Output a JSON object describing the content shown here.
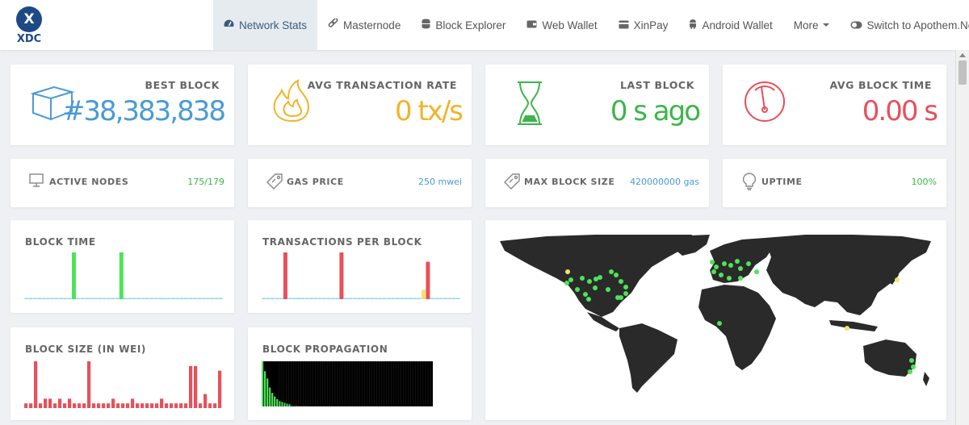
{
  "brand": {
    "logo_letter": "X",
    "name": "XDC"
  },
  "nav": {
    "items": [
      {
        "label": "Network Stats",
        "icon": "gauge-icon",
        "active": true
      },
      {
        "label": "Masternode",
        "icon": "link-icon"
      },
      {
        "label": "Block Explorer",
        "icon": "database-icon"
      },
      {
        "label": "Web Wallet",
        "icon": "wallet-icon"
      },
      {
        "label": "XinPay",
        "icon": "card-icon"
      },
      {
        "label": "Android Wallet",
        "icon": "android-icon"
      },
      {
        "label": "More",
        "icon": "caret-down-icon"
      },
      {
        "label": "Switch to Apothem.Network",
        "icon": "toggle-icon"
      }
    ]
  },
  "stats": {
    "best_block": {
      "label": "BEST BLOCK",
      "value": "#38,383,838",
      "color": "#4a9bd4"
    },
    "avg_tx_rate": {
      "label": "AVG TRANSACTION RATE",
      "value": "0 tx/s",
      "color": "#f0b429"
    },
    "last_block": {
      "label": "LAST BLOCK",
      "value": "0 s ago",
      "color": "#3cb54a"
    },
    "avg_block_time": {
      "label": "AVG BLOCK TIME",
      "value": "0.00 s",
      "color": "#e8505b"
    }
  },
  "small_stats": {
    "active_nodes": {
      "label": "ACTIVE NODES",
      "value": "175/179",
      "color": "#3cb54a"
    },
    "gas_price": {
      "label": "GAS PRICE",
      "value": "250 mwei",
      "color": "#4a9bd4"
    },
    "max_block_size": {
      "label": "MAX BLOCK SIZE",
      "value": "420000000 gas",
      "color": "#4a9bd4"
    },
    "uptime": {
      "label": "UPTIME",
      "value": "100%",
      "color": "#3cb54a"
    }
  },
  "charts": {
    "block_time": {
      "label": "BLOCK TIME"
    },
    "transactions_per_block": {
      "label": "TRANSACTIONS PER BLOCK"
    },
    "block_size": {
      "label": "BLOCK SIZE (IN WEI)"
    },
    "block_propagation": {
      "label": "BLOCK PROPAGATION"
    }
  },
  "chart_data": [
    {
      "type": "bar",
      "title": "BLOCK TIME",
      "values": [
        0,
        0,
        0,
        0,
        0,
        0,
        0,
        0,
        0,
        0,
        0,
        10,
        0,
        0,
        0,
        0,
        0,
        0,
        0,
        0,
        0,
        0,
        10,
        0,
        0,
        0,
        0,
        0,
        0,
        0,
        0,
        0,
        0,
        0,
        0,
        0,
        0,
        0,
        0,
        0,
        0,
        0,
        0,
        0,
        0,
        0
      ],
      "colors": {
        "high": "#4ee35a",
        "zero": "#8fd3ea"
      }
    },
    {
      "type": "bar",
      "title": "TRANSACTIONS PER BLOCK",
      "values": [
        0,
        0,
        0,
        0,
        0,
        10,
        0,
        0,
        0,
        0,
        0,
        0,
        0,
        0,
        0,
        0,
        0,
        0,
        10,
        0,
        0,
        0,
        0,
        0,
        0,
        0,
        0,
        0,
        0,
        0,
        0,
        0,
        0,
        0,
        0,
        0,
        0,
        2,
        8,
        0,
        0,
        0,
        0,
        0,
        0,
        0
      ],
      "highlight_index": 37,
      "colors": {
        "high": "#e8505b",
        "highlight": "#f2e36f",
        "zero": "#8fd3ea"
      }
    },
    {
      "type": "bar",
      "title": "BLOCK SIZE (IN WEI)",
      "values": [
        1,
        1,
        10,
        1,
        2,
        2,
        1,
        2,
        1,
        2,
        1,
        1,
        1,
        10,
        1,
        1,
        1,
        1,
        2,
        1,
        1,
        1,
        2,
        1,
        1,
        1,
        1,
        1,
        2,
        1,
        1,
        1,
        1,
        1,
        9,
        9,
        1,
        3,
        1,
        1,
        8
      ],
      "color": "#e8505b"
    },
    {
      "type": "histogram",
      "title": "BLOCK PROPAGATION",
      "values": [
        100,
        78,
        62,
        42,
        30,
        22,
        16,
        12,
        10,
        8,
        6,
        5,
        4,
        3,
        3,
        2,
        2,
        2,
        2,
        1,
        1,
        1,
        1,
        1,
        1,
        1,
        1,
        1,
        1,
        1,
        1,
        1,
        1,
        1,
        1,
        1,
        1,
        1,
        1,
        1,
        1,
        1,
        1,
        1,
        1,
        1,
        1,
        1,
        1,
        1,
        1,
        1,
        1,
        1,
        1,
        1,
        1,
        1,
        1,
        1,
        1,
        1,
        1,
        1,
        1,
        1,
        1,
        1,
        1,
        1
      ],
      "colors": {
        "bar": "#4ee35a",
        "background": "#000000"
      }
    }
  ],
  "map": {
    "land_color": "#2a2a2a",
    "node_color": "#4ee35a",
    "highlight_color": "#f2e36f"
  }
}
